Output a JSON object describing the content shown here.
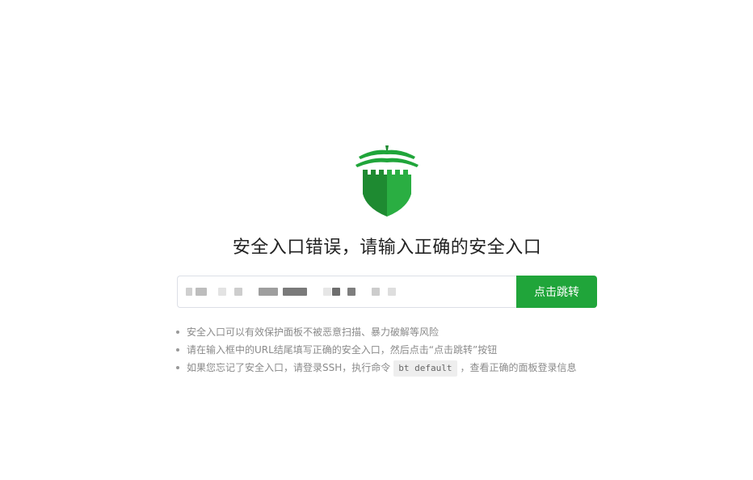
{
  "page": {
    "title": "安全入口错误，请输入正确的安全入口"
  },
  "form": {
    "url_input_value": "",
    "jump_button_label": "点击跳转"
  },
  "tips": {
    "item1": "安全入口可以有效保护面板不被恶意扫描、暴力破解等风险",
    "item2": "请在输入框中的URL结尾填写正确的安全入口，然后点击“点击跳转”按钮",
    "item3_before": "如果您忘记了安全入口，请登录SSH，执行命令",
    "item3_code": "bt default",
    "item3_after": "，查看正确的面板登录信息"
  },
  "colors": {
    "accent": "#20a53a",
    "logo_dark": "#1e8a31",
    "logo_light": "#2aae42"
  },
  "icons": {
    "logo": "shield-castle-icon"
  }
}
